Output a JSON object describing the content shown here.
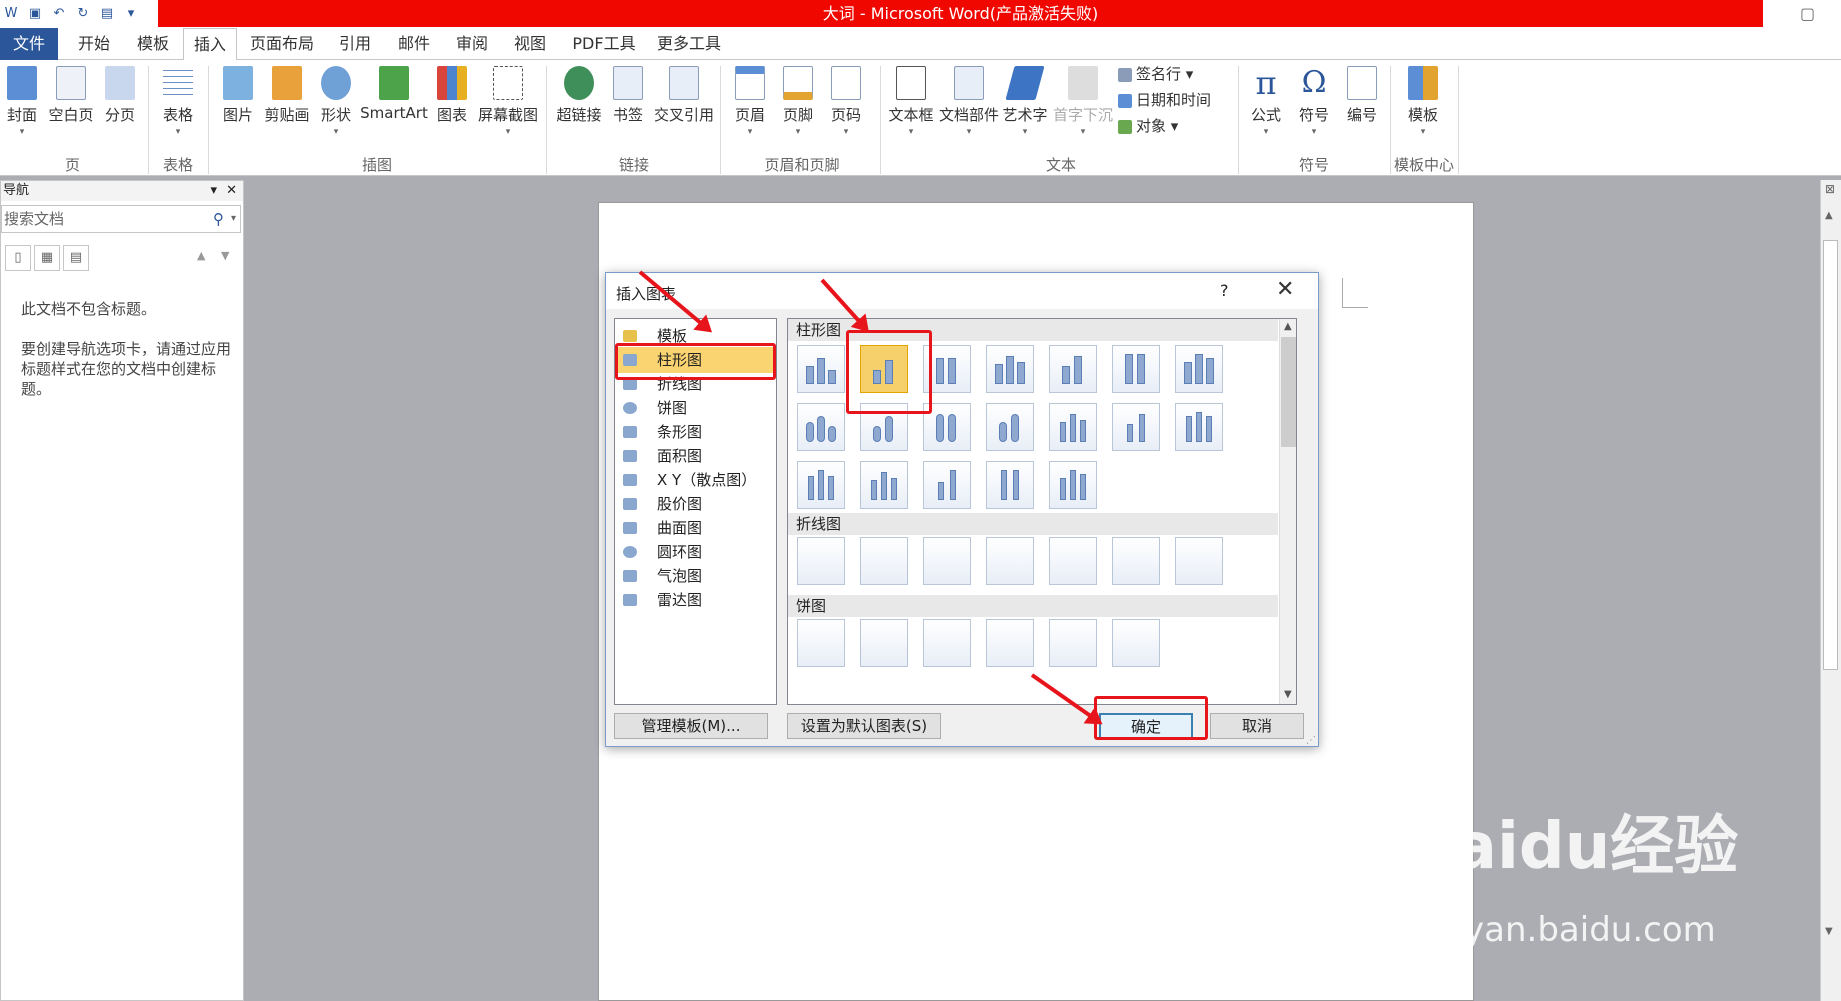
{
  "window": {
    "title": "大词 - Microsoft Word(产品激活失败)"
  },
  "tabs": [
    "文件",
    "开始",
    "模板",
    "插入",
    "页面布局",
    "引用",
    "邮件",
    "审阅",
    "视图",
    "PDF工具",
    "更多工具"
  ],
  "ribbon": {
    "page_group": {
      "label": "页",
      "buttons": [
        "封面",
        "空白页",
        "分页"
      ]
    },
    "table_group": {
      "label": "表格",
      "buttons": [
        "表格"
      ]
    },
    "illustration_group": {
      "label": "插图",
      "buttons": [
        "图片",
        "剪贴画",
        "形状",
        "SmartArt",
        "图表",
        "屏幕截图"
      ]
    },
    "link_group": {
      "label": "链接",
      "buttons": [
        "超链接",
        "书签",
        "交叉引用"
      ]
    },
    "header_footer_group": {
      "label": "页眉和页脚",
      "buttons": [
        "页眉",
        "页脚",
        "页码"
      ]
    },
    "text_group": {
      "label": "文本",
      "buttons": [
        "文本框",
        "文档部件",
        "艺术字",
        "首字下沉"
      ],
      "small": [
        "签名行",
        "日期和时间",
        "对象"
      ]
    },
    "symbol_group": {
      "label": "符号",
      "buttons": [
        "公式",
        "符号",
        "编号"
      ]
    },
    "template_group": {
      "label": "模板中心",
      "buttons": [
        "模板"
      ]
    }
  },
  "nav": {
    "title": "导航",
    "search_placeholder": "搜索文档",
    "empty_line1": "此文档不包含标题。",
    "empty_line2": "要创建导航选项卡，请通过应用标题样式在您的文档中创建标题。"
  },
  "dialog": {
    "title": "插入图表",
    "help": "?",
    "categories": [
      "模板",
      "柱形图",
      "折线图",
      "饼图",
      "条形图",
      "面积图",
      "X Y（散点图）",
      "股价图",
      "曲面图",
      "圆环图",
      "气泡图",
      "雷达图"
    ],
    "selected_category": "柱形图",
    "sections": [
      "柱形图",
      "折线图",
      "饼图"
    ],
    "manage_templates": "管理模板(M)...",
    "set_default": "设置为默认图表(S)",
    "ok": "确定",
    "cancel": "取消"
  },
  "watermark": {
    "line1": "Baidu经验",
    "line2": "jingyan.baidu.com"
  }
}
